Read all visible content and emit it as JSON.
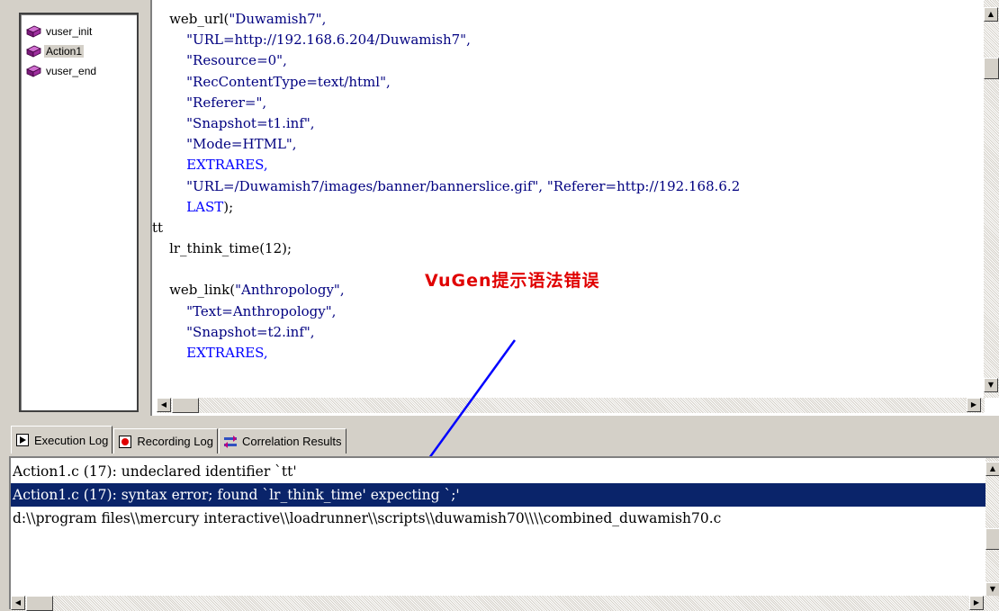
{
  "tree": {
    "items": [
      {
        "label": "vuser_init",
        "selected": false
      },
      {
        "label": "Action1",
        "selected": true
      },
      {
        "label": "vuser_end",
        "selected": false
      }
    ]
  },
  "code_lines": [
    {
      "indent": "    ",
      "parts": [
        {
          "t": "web_url(",
          "c": "fn"
        },
        {
          "t": "\"Duwamish7\",",
          "c": "str"
        }
      ]
    },
    {
      "indent": "        ",
      "parts": [
        {
          "t": "\"URL=http://192.168.6.204/Duwamish7\",",
          "c": "str"
        }
      ]
    },
    {
      "indent": "        ",
      "parts": [
        {
          "t": "\"Resource=0\",",
          "c": "str"
        }
      ]
    },
    {
      "indent": "        ",
      "parts": [
        {
          "t": "\"RecContentType=text/html\",",
          "c": "str"
        }
      ]
    },
    {
      "indent": "        ",
      "parts": [
        {
          "t": "\"Referer=\",",
          "c": "str"
        }
      ]
    },
    {
      "indent": "        ",
      "parts": [
        {
          "t": "\"Snapshot=t1.inf\",",
          "c": "str"
        }
      ]
    },
    {
      "indent": "        ",
      "parts": [
        {
          "t": "\"Mode=HTML\",",
          "c": "str"
        }
      ]
    },
    {
      "indent": "        ",
      "parts": [
        {
          "t": "EXTRARES,",
          "c": "const"
        }
      ]
    },
    {
      "indent": "        ",
      "parts": [
        {
          "t": "\"URL=/Duwamish7/images/banner/bannerslice.gif\", \"Referer=http://192.168.6.2",
          "c": "str"
        }
      ]
    },
    {
      "indent": "        ",
      "parts": [
        {
          "t": "LAST",
          "c": "const"
        },
        {
          "t": ");",
          "c": "plain"
        }
      ]
    },
    {
      "indent": "",
      "parts": [
        {
          "t": "tt",
          "c": "plain"
        }
      ]
    },
    {
      "indent": "    ",
      "parts": [
        {
          "t": "lr_think_time(12);",
          "c": "plain"
        }
      ]
    },
    {
      "indent": "",
      "parts": []
    },
    {
      "indent": "    ",
      "parts": [
        {
          "t": "web_link(",
          "c": "fn"
        },
        {
          "t": "\"Anthropology\",",
          "c": "str"
        }
      ]
    },
    {
      "indent": "        ",
      "parts": [
        {
          "t": "\"Text=Anthropology\",",
          "c": "str"
        }
      ]
    },
    {
      "indent": "        ",
      "parts": [
        {
          "t": "\"Snapshot=t2.inf\",",
          "c": "str"
        }
      ]
    },
    {
      "indent": "        ",
      "parts": [
        {
          "t": "EXTRARES,",
          "c": "const"
        }
      ]
    }
  ],
  "annotation": {
    "text": "VuGen提示语法错误"
  },
  "tabs": [
    {
      "label": "Execution Log",
      "icon": "execution-log-icon",
      "active": true
    },
    {
      "label": "Recording Log",
      "icon": "recording-log-icon",
      "active": false
    },
    {
      "label": "Correlation Results",
      "icon": "correlation-icon",
      "active": false
    }
  ],
  "log": {
    "lines": [
      {
        "text": "Action1.c (17): undeclared identifier `tt'",
        "selected": false
      },
      {
        "text": "Action1.c (17): syntax error; found `lr_think_time' expecting `;'",
        "selected": true
      },
      {
        "text": "d:\\\\program files\\\\mercury interactive\\\\loadrunner\\\\scripts\\\\duwamish70\\\\\\\\combined_duwamish70.c",
        "selected": false
      }
    ]
  },
  "colors": {
    "string": "#000080",
    "constant": "#0000ff",
    "annotation": "#e00000",
    "selection": "#0a246a",
    "chrome": "#d4d0c8"
  }
}
